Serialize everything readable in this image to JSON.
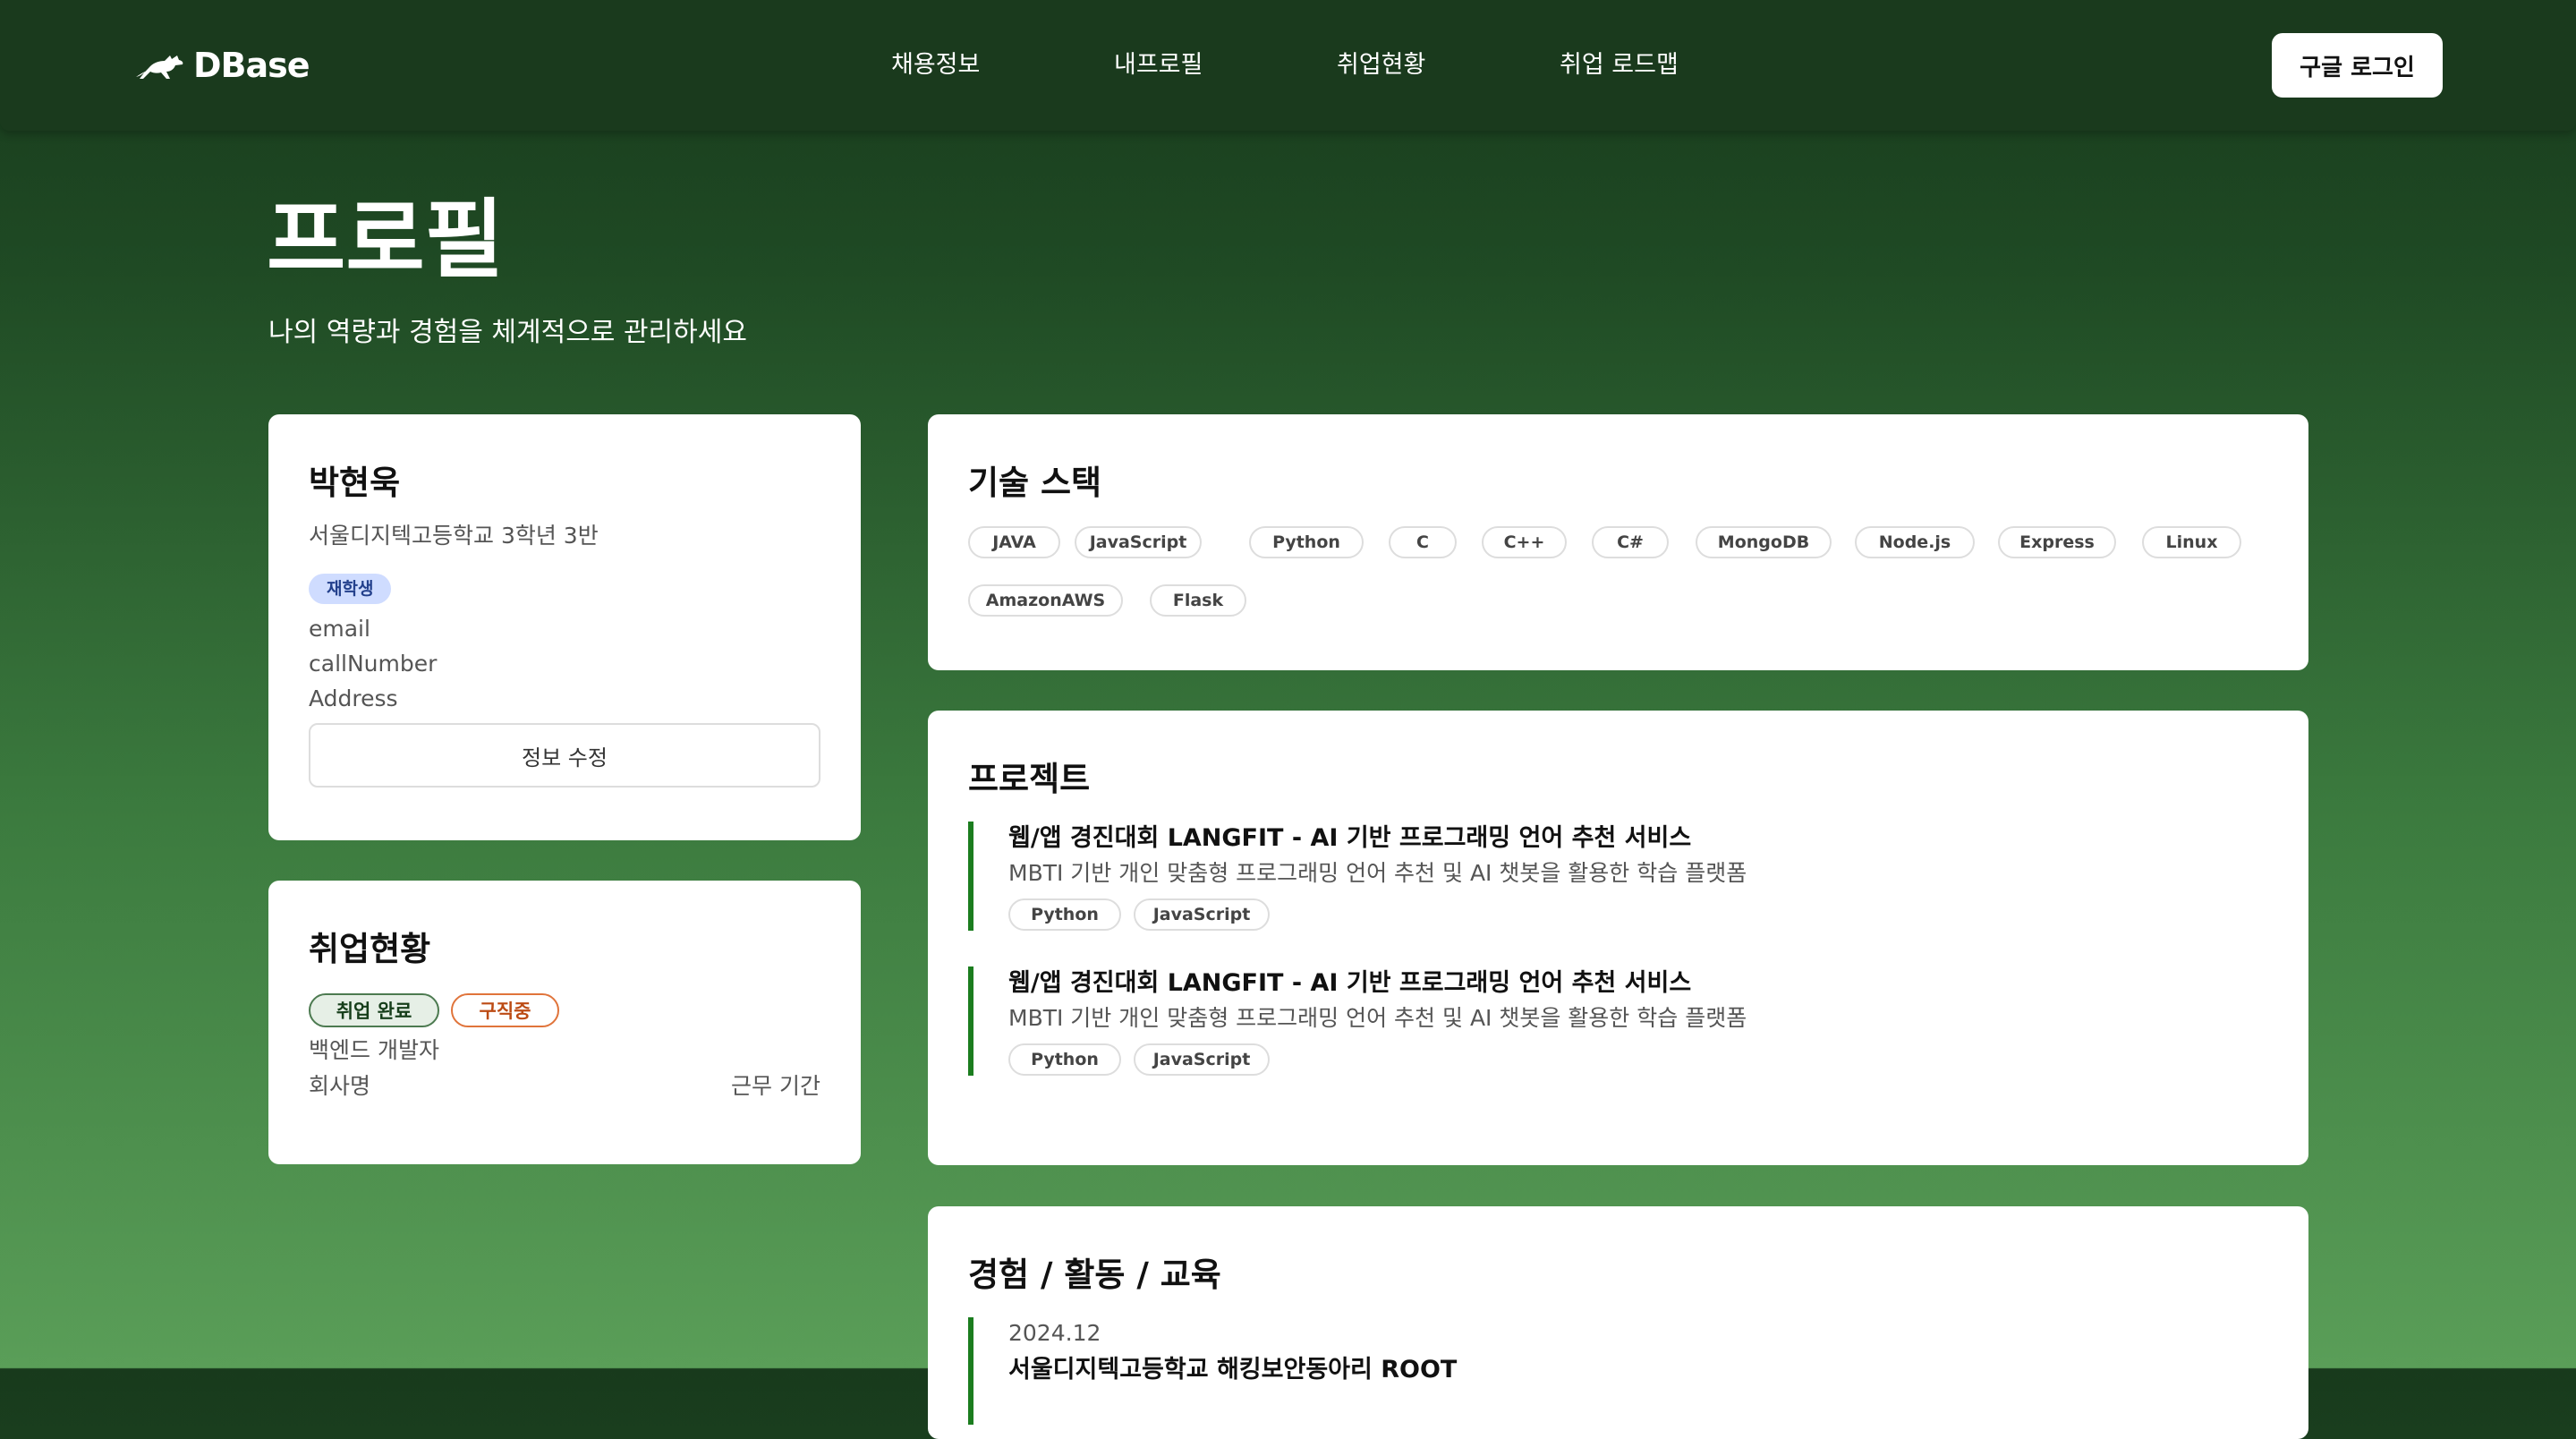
{
  "header": {
    "logo_text": "DBase",
    "logo_icon": "leaping-cat-icon",
    "nav": [
      {
        "label": "채용정보"
      },
      {
        "label": "내프로필"
      },
      {
        "label": "취업현황"
      },
      {
        "label": "취업 로드맵"
      }
    ],
    "login_label": "구글 로그인"
  },
  "page": {
    "title": "프로필",
    "subtitle": "나의 역량과 경험을 체계적으로 관리하세요"
  },
  "profile": {
    "name": "박현욱",
    "school": "서울디지텍고등학교 3학년 3반",
    "status_badge": "재학생",
    "email": "email",
    "phone": "callNumber",
    "address": "Address",
    "edit_label": "정보 수정"
  },
  "employment": {
    "title": "취업현황",
    "status_done": "취업 완료",
    "status_seeking": "구직중",
    "role": "백엔드 개발자",
    "company_label": "회사명",
    "period_label": "근무 기간"
  },
  "skills": {
    "title": "기술 스택",
    "tags": [
      "JAVA",
      "JavaScript",
      "Python",
      "C",
      "C++",
      "C#",
      "MongoDB",
      "Node.js",
      "Express",
      "Linux",
      "AmazonAWS",
      "Flask"
    ]
  },
  "projects": {
    "title": "프로젝트",
    "items": [
      {
        "title": "웹/앱 경진대회 LANGFIT - AI 기반 프로그래밍 언어 추천 서비스",
        "description": "MBTI 기반 개인 맞춤형 프로그래밍 언어 추천 및 AI 챗봇을 활용한 학습 플랫폼",
        "tags": [
          "Python",
          "JavaScript"
        ]
      },
      {
        "title": "웹/앱 경진대회 LANGFIT - AI 기반 프로그래밍 언어 추천 서비스",
        "description": "MBTI 기반 개인 맞춤형 프로그래밍 언어 추천 및 AI 챗봇을 활용한 학습 플랫폼",
        "tags": [
          "Python",
          "JavaScript"
        ]
      }
    ]
  },
  "experience": {
    "title": "경험 / 활동 / 교육",
    "items": [
      {
        "date": "2024.12",
        "title": "서울디지텍고등학교 해킹보안동아리 ROOT"
      }
    ]
  },
  "colors": {
    "header_bg": "#1a3a1d",
    "accent_green": "#1b7d1f",
    "badge_blue": "#cfdcff",
    "seeking_orange": "#e0743b"
  }
}
